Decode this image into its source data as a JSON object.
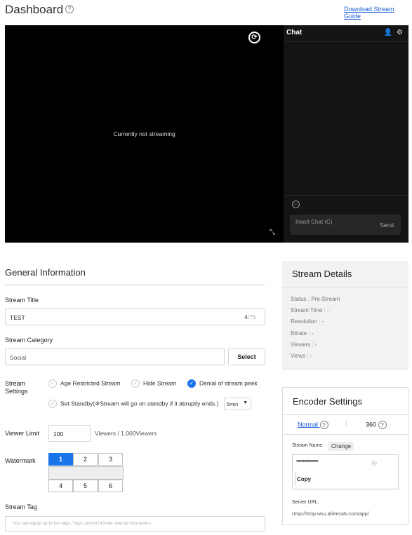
{
  "header": {
    "title": "Dashboard",
    "help_icon": "?",
    "guide_link": "Download Stream Guide"
  },
  "player": {
    "status_message": "Currently not streaming",
    "refresh_icon": "refresh-icon",
    "expand_icon": "expand-icon"
  },
  "chat": {
    "title": "Chat",
    "icons": [
      "user-list-icon",
      "gear-icon"
    ],
    "emoji_icon": "smiley-icon",
    "input_placeholder": "Insert Chat (C)",
    "send_label": "Send"
  },
  "general": {
    "title": "General Information",
    "stream_title_label": "Stream Title",
    "stream_title_value": "TEST",
    "stream_title_count": "4",
    "stream_title_max": "/75",
    "category_label": "Stream Category",
    "category_value": "Social",
    "select_label": "Select",
    "settings_label_1": "Stream",
    "settings_label_2": "Settings",
    "settings": [
      {
        "label": "Age Restricted Stream",
        "checked": false
      },
      {
        "label": "Hide Stream",
        "checked": false
      },
      {
        "label": "Denial of stream peek",
        "checked": true
      },
      {
        "label": "Set Standby(※Stream will go on standby if it abruptly ends.)",
        "checked": false
      }
    ],
    "standby_value": "5min",
    "viewer_limit_label": "Viewer Limit",
    "viewer_limit_value": "100",
    "viewer_limit_suffix": "Viewers / 1,000Viewers",
    "watermark_label": "Watermark",
    "watermark_cells": [
      "1",
      "2",
      "3",
      "4",
      "5",
      "6"
    ],
    "watermark_selected": "1",
    "tag_label": "Stream Tag",
    "tag_placeholder": "You can apply up to ten tags. Tags cannot include special characters."
  },
  "details": {
    "title": "Stream Details",
    "rows": [
      "Status :  Pre-Stream",
      "Stream Time :  -",
      "Resolution :  -",
      "Bitrate :  -",
      "Viewers :  -",
      "Views :  -"
    ]
  },
  "encoder": {
    "title": "Encoder Settings",
    "quality_normal": "Normal",
    "quality_360": "360",
    "stream_name_label": "Stream Name",
    "change_label": "Change",
    "stream_key_masked": "•••••••••••••••••",
    "eye_icon": "eye-off-icon",
    "copy_label": "Copy",
    "server_url_label": "Server URL:",
    "server_url": "rtmp://rtmp-wsu.afreecatv.com/app/"
  },
  "colors": {
    "accent": "#1a73e8",
    "link": "#1a5bd6",
    "player_bg": "#000000",
    "chat_bg": "#141414"
  }
}
